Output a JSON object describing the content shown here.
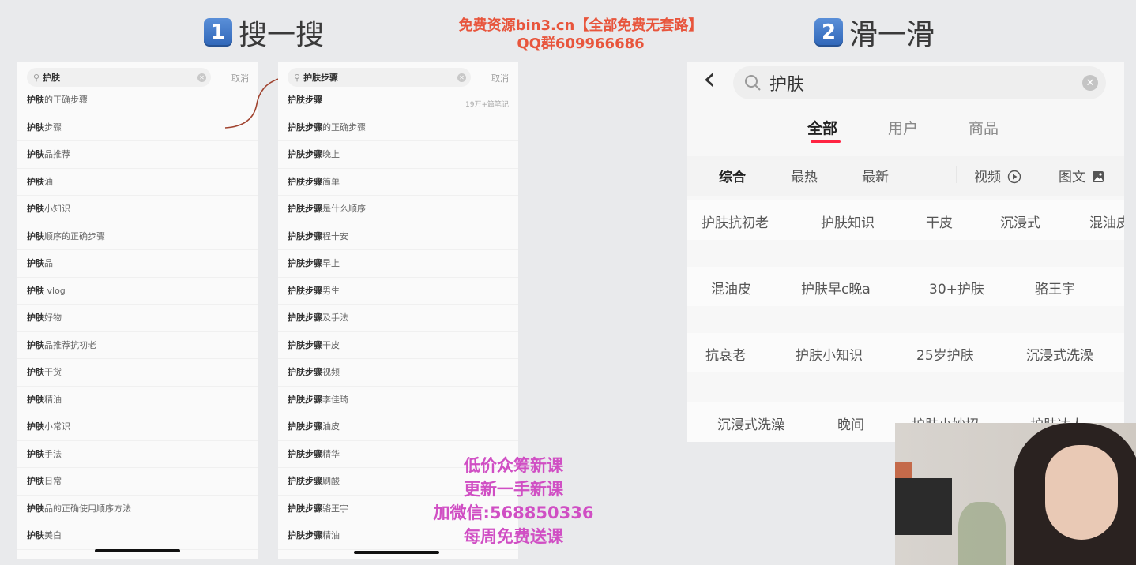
{
  "left_heading": {
    "number": "1",
    "title": "搜一搜"
  },
  "right_heading": {
    "number": "2",
    "title": "滑一滑"
  },
  "watermark_top": {
    "line1": "免费资源bin3.cn【全部免费无套路】",
    "line2": "QQ群609966686"
  },
  "watermark_bottom": {
    "line1": "低价众筹新课",
    "line2": "更新一手新课",
    "line3": "加微信:568850336",
    "line4": "每周免费送课"
  },
  "panel1": {
    "search_query": "护肤",
    "cancel": "取消",
    "items": [
      {
        "bold": "护肤",
        "rest": "的正确步骤"
      },
      {
        "bold": "护肤",
        "rest": "步骤"
      },
      {
        "bold": "护肤",
        "rest": "品推荐"
      },
      {
        "bold": "护肤",
        "rest": "油"
      },
      {
        "bold": "护肤",
        "rest": "小知识"
      },
      {
        "bold": "护肤",
        "rest": "顺序的正确步骤"
      },
      {
        "bold": "护肤",
        "rest": "品"
      },
      {
        "bold": "护肤",
        "rest": " vlog"
      },
      {
        "bold": "护肤",
        "rest": "好物"
      },
      {
        "bold": "护肤",
        "rest": "品推荐抗初老"
      },
      {
        "bold": "护肤",
        "rest": "干货"
      },
      {
        "bold": "护肤",
        "rest": "精油"
      },
      {
        "bold": "护肤",
        "rest": "小常识"
      },
      {
        "bold": "护肤",
        "rest": "手法"
      },
      {
        "bold": "护肤",
        "rest": "日常"
      },
      {
        "bold": "护肤",
        "rest": "品的正确使用顺序方法"
      },
      {
        "bold": "护肤",
        "rest": "美白"
      }
    ]
  },
  "panel2": {
    "search_query": "护肤步骤",
    "cancel": "取消",
    "first_count": "19万+篇笔记",
    "items": [
      {
        "bold": "护肤步骤",
        "rest": ""
      },
      {
        "bold": "护肤步骤",
        "rest": "的正确步骤"
      },
      {
        "bold": "护肤步骤",
        "rest": "晚上"
      },
      {
        "bold": "护肤步骤",
        "rest": "简单"
      },
      {
        "bold": "护肤步骤",
        "rest": "是什么顺序"
      },
      {
        "bold": "护肤步骤",
        "rest": "程十安"
      },
      {
        "bold": "护肤步骤",
        "rest": "早上"
      },
      {
        "bold": "护肤步骤",
        "rest": "男生"
      },
      {
        "bold": "护肤步骤",
        "rest": "及手法"
      },
      {
        "bold": "护肤步骤",
        "rest": "干皮"
      },
      {
        "bold": "护肤步骤",
        "rest": "视频"
      },
      {
        "bold": "护肤步骤",
        "rest": "李佳琦"
      },
      {
        "bold": "护肤步骤",
        "rest": "油皮"
      },
      {
        "bold": "护肤步骤",
        "rest": "精华"
      },
      {
        "bold": "护肤步骤",
        "rest": "刷酸"
      },
      {
        "bold": "护肤步骤",
        "rest": "骆王宇"
      },
      {
        "bold": "护肤步骤",
        "rest": "精油"
      }
    ]
  },
  "panel3": {
    "back": "‹",
    "search_query": "护肤",
    "tabs": [
      "全部",
      "用户",
      "商品"
    ],
    "filters": [
      "综合",
      "最热",
      "最新"
    ],
    "filter_video": "视频",
    "filter_image": "图文",
    "chip_rows": [
      [
        "护肤抗初老",
        "护肤知识",
        "干皮",
        "沉浸式",
        "混油皮"
      ],
      [
        "混油皮",
        "护肤早c晚a",
        "30+护肤",
        "骆王宇"
      ],
      [
        "抗衰老",
        "护肤小知识",
        "25岁护肤",
        "沉浸式洗澡"
      ],
      [
        "沉浸式洗澡",
        "晚间",
        "护肤小妙招",
        "护肤达人"
      ]
    ]
  },
  "colors": {
    "accent_red": "#ff2442",
    "watermark_red": "#e8553c",
    "watermark_pink": "#d04fc4",
    "badge_blue": "#2f66b8"
  }
}
